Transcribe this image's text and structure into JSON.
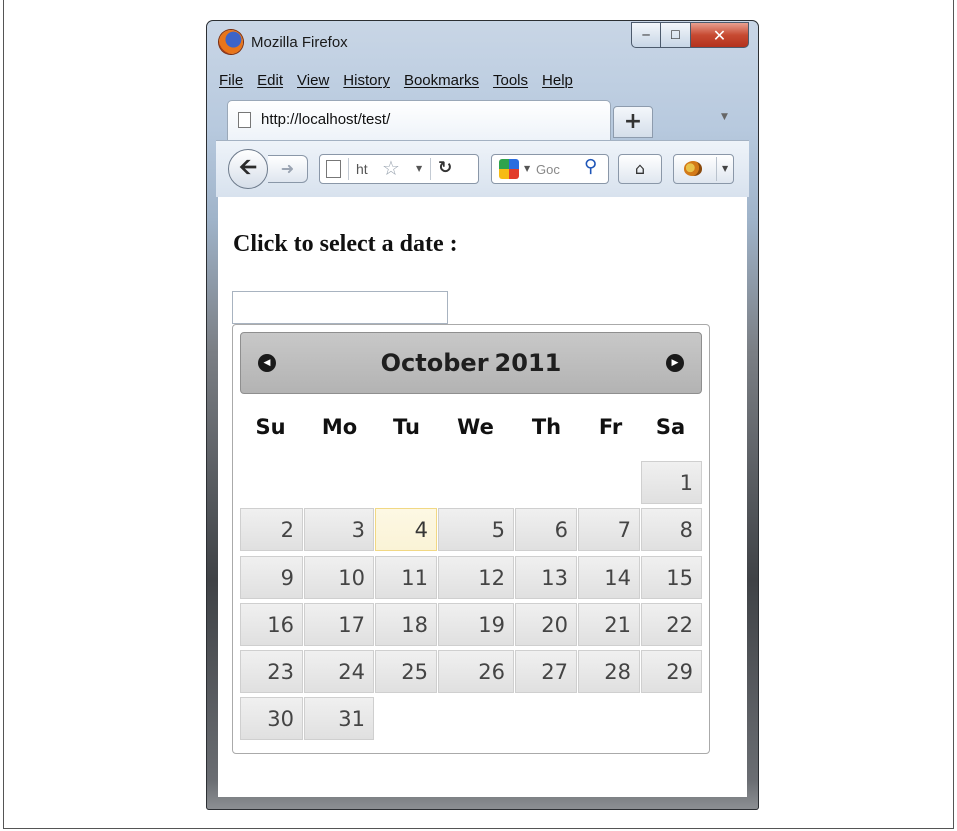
{
  "window": {
    "title": "Mozilla Firefox"
  },
  "menubar": {
    "items": [
      "File",
      "Edit",
      "View",
      "History",
      "Bookmarks",
      "Tools",
      "Help"
    ]
  },
  "tab": {
    "title": "http://localhost/test/",
    "new_tab_label": "+"
  },
  "navbar": {
    "url_text": "ht",
    "search_text": "Goc"
  },
  "page": {
    "heading": "Click to select a date :",
    "input_value": ""
  },
  "datepicker": {
    "month": "October",
    "year": "2011",
    "weekdays": [
      "Su",
      "Mo",
      "Tu",
      "We",
      "Th",
      "Fr",
      "Sa"
    ],
    "days": [
      "1",
      "2",
      "3",
      "4",
      "5",
      "6",
      "7",
      "8",
      "9",
      "10",
      "11",
      "12",
      "13",
      "14",
      "15",
      "16",
      "17",
      "18",
      "19",
      "20",
      "21",
      "22",
      "23",
      "24",
      "25",
      "26",
      "27",
      "28",
      "29",
      "30",
      "31"
    ],
    "today": "4"
  },
  "icons": [
    "firefox-icon",
    "minimize-icon",
    "maximize-icon",
    "close-icon",
    "page-icon",
    "star-icon",
    "reload-icon",
    "google-icon",
    "search-icon",
    "home-icon",
    "addon-icon",
    "back-arrow-icon",
    "forward-arrow-icon",
    "prev-month-icon",
    "next-month-icon"
  ]
}
